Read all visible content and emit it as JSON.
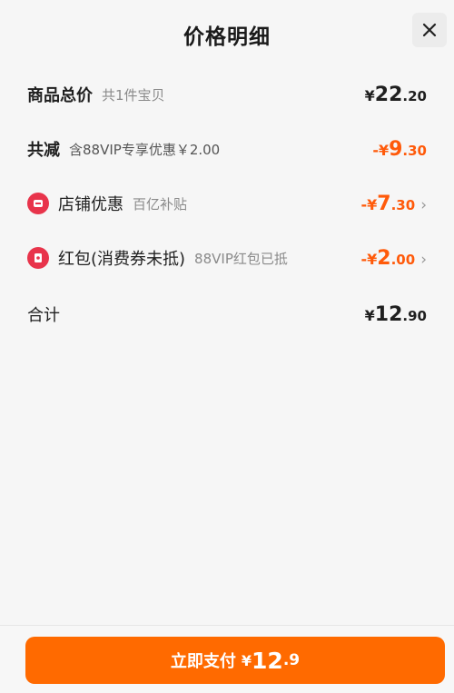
{
  "header": {
    "title": "价格明细",
    "close_icon": "close-icon"
  },
  "rows": {
    "subtotal": {
      "label": "商品总价",
      "sub": "共1件宝贝",
      "price": {
        "sign": "¥",
        "int": "22",
        "dec": ".20"
      }
    },
    "reduction": {
      "label": "共减",
      "sub": "含88VIP专享优惠￥2.00",
      "price": {
        "sign": "-¥",
        "int": "9",
        "dec": ".30"
      }
    },
    "store_discount": {
      "icon": "store-discount-icon",
      "label": "店铺优惠",
      "sub": "百亿补贴",
      "price": {
        "sign": "-¥",
        "int": "7",
        "dec": ".30"
      },
      "chevron": "›"
    },
    "red_packet": {
      "icon": "red-packet-icon",
      "label": "红包(消费券未抵)",
      "sub": "88VIP红包已抵",
      "price": {
        "sign": "-¥",
        "int": "2",
        "dec": ".00"
      },
      "chevron": "›"
    },
    "total": {
      "label": "合计",
      "price": {
        "sign": "¥",
        "int": "12",
        "dec": ".90"
      }
    }
  },
  "footer": {
    "pay_label": "立即支付",
    "price": {
      "sign": "¥",
      "int": "12",
      "dec": ".9"
    }
  },
  "colors": {
    "accent": "#ff6a00",
    "discount": "#ff5a0a",
    "icon_red": "#e8344b"
  }
}
